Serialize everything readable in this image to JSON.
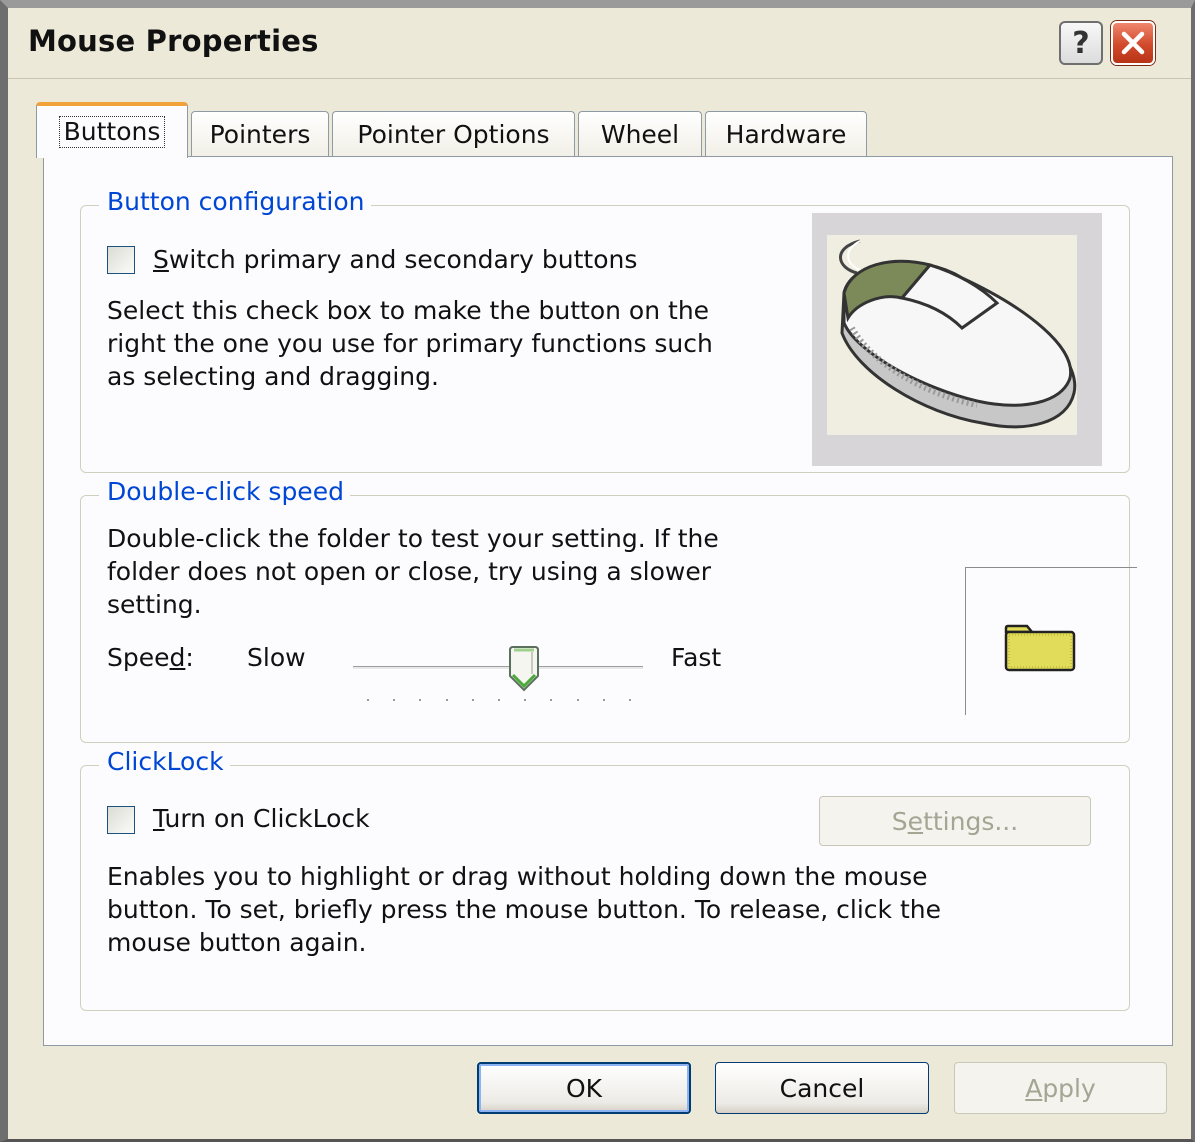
{
  "window": {
    "title": "Mouse Properties",
    "help_label": "?"
  },
  "tabs": [
    {
      "label": "Buttons",
      "active": true
    },
    {
      "label": "Pointers",
      "active": false
    },
    {
      "label": "Pointer Options",
      "active": false
    },
    {
      "label": "Wheel",
      "active": false
    },
    {
      "label": "Hardware",
      "active": false
    }
  ],
  "button_config": {
    "legend": "Button configuration",
    "checkbox_accel": "S",
    "checkbox_rest": "witch primary and secondary buttons",
    "checked": false,
    "description_lines": [
      "Select this check box to make the button on the",
      "right the one you use for primary functions such",
      "as selecting and dragging."
    ]
  },
  "double_click": {
    "legend": "Double-click speed",
    "description_lines": [
      "Double-click the folder to test your setting. If the",
      "folder does not open or close, try using a slower",
      "setting."
    ],
    "speed_label_pre": "Spee",
    "speed_label_accel": "d",
    "speed_label_post": ":",
    "slow_label": "Slow",
    "fast_label": "Fast",
    "slider_value": 0.6,
    "tick_count": 11
  },
  "clicklock": {
    "legend": "ClickLock",
    "checkbox_accel": "T",
    "checkbox_rest": "urn on ClickLock",
    "checked": false,
    "settings_pre": "S",
    "settings_accel": "e",
    "settings_post": "ttings...",
    "settings_enabled": false,
    "description_lines": [
      "Enables you to highlight or drag without holding down the mouse",
      "button. To set, briefly press the mouse button. To release, click the",
      "mouse button again."
    ]
  },
  "footer": {
    "ok_label": "OK",
    "cancel_label": "Cancel",
    "apply_accel": "A",
    "apply_rest": "pply",
    "apply_enabled": false
  },
  "colors": {
    "legend_blue": "#0046d5",
    "dialog_bg": "#ece9d8",
    "tab_highlight": "#f1a33a",
    "mouse_button_green": "#7c8a5a",
    "folder_yellow": "#e1dc5a"
  }
}
